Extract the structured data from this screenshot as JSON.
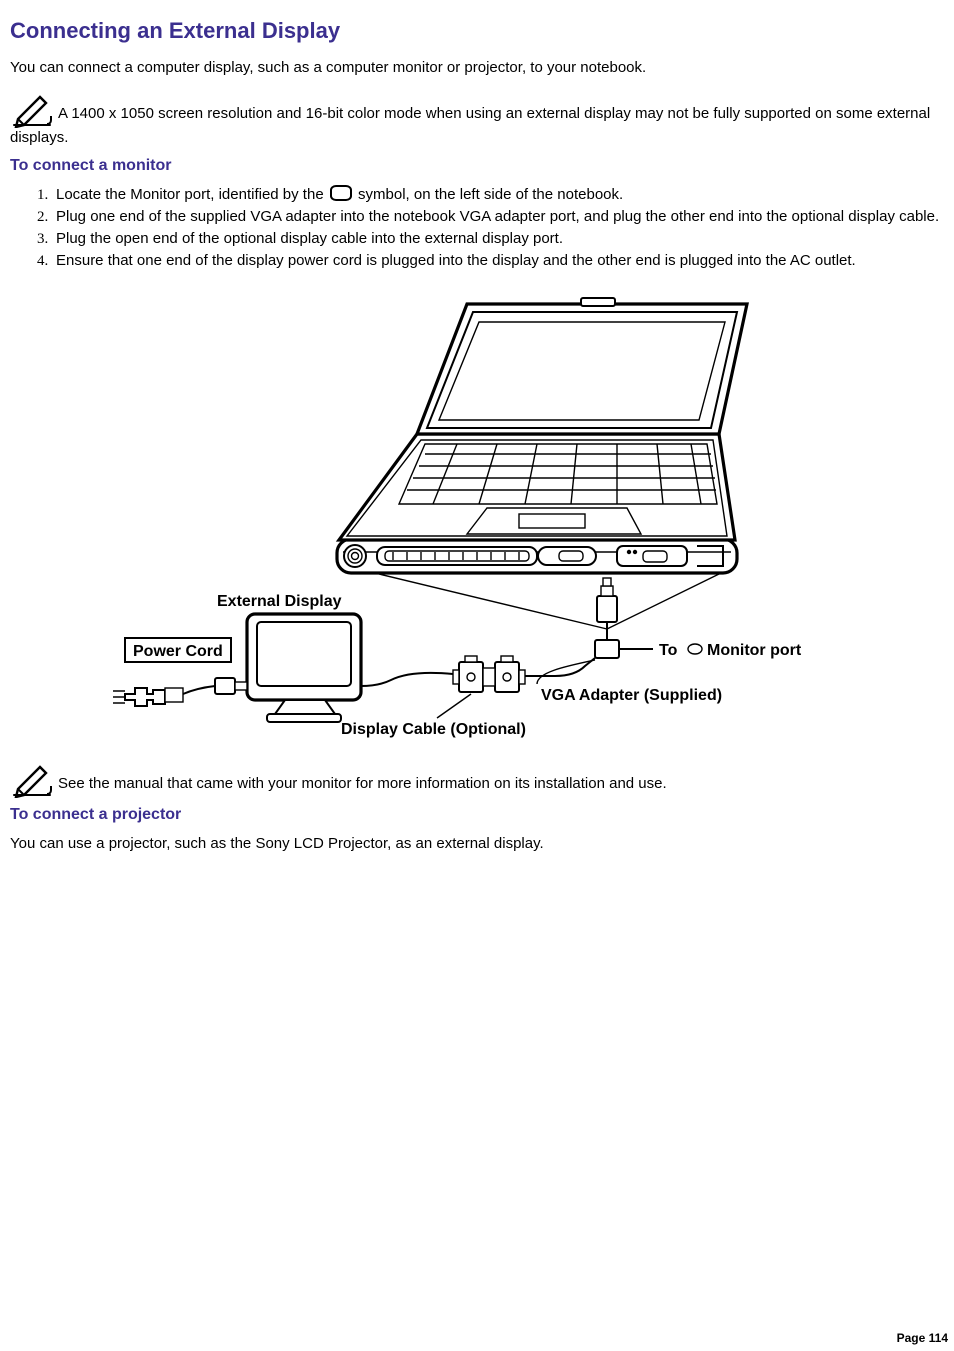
{
  "title": "Connecting an External Display",
  "intro": "You can connect a computer display, such as a computer monitor or projector, to your notebook.",
  "note1": "A 1400 x 1050 screen resolution and 16-bit color mode when using an external display may not be fully supported on some external displays.",
  "section_monitor_heading": "To connect a monitor",
  "steps": {
    "s1a": "Locate the Monitor port, identified by the ",
    "s1b": " symbol, on the left side of the notebook.",
    "s2": "Plug one end of the supplied VGA adapter into the notebook VGA adapter port, and plug the other end into the optional display cable.",
    "s3": "Plug the open end of the optional display cable into the external display port.",
    "s4": "Ensure that one end of the display power cord is plugged into the display and the other end is plugged into the AC outlet."
  },
  "figure": {
    "external_display": "External Display",
    "power_cord": "Power Cord",
    "to_port_prefix": "To ",
    "to_port_suffix": " Monitor port",
    "vga_adapter": "VGA Adapter (Supplied)",
    "display_cable": "Display Cable (Optional)"
  },
  "note2": "See the manual that came with your monitor for more information on its installation and use.",
  "section_projector_heading": "To connect a projector",
  "projector_para": "You can use a projector, such as the Sony LCD Projector, as an external display.",
  "page_number": "Page 114"
}
